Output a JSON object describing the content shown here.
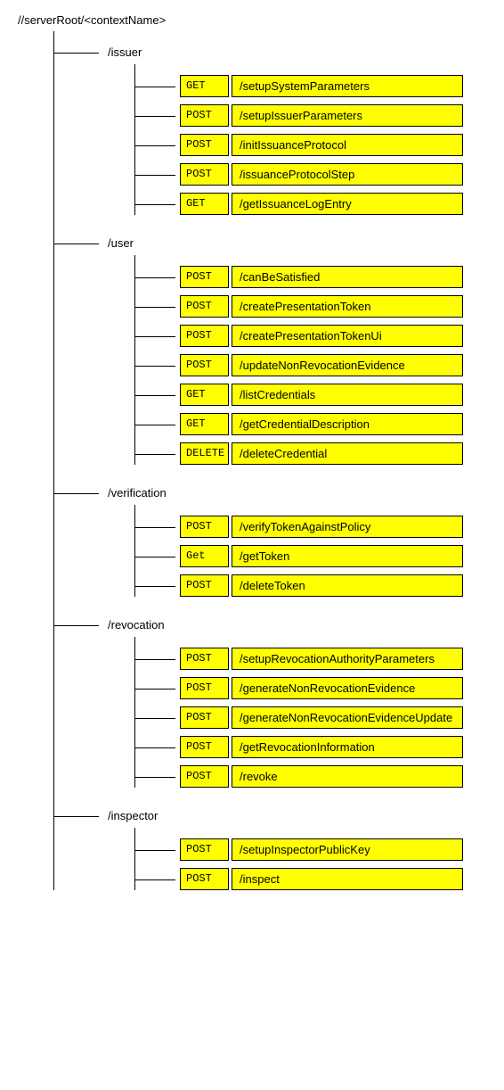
{
  "root": "//serverRoot/<contextName>",
  "sections": [
    {
      "title": "/issuer",
      "endpoints": [
        {
          "method": "GET",
          "path": "/setupSystemParameters"
        },
        {
          "method": "POST",
          "path": "/setupIssuerParameters"
        },
        {
          "method": "POST",
          "path": "/initIssuanceProtocol"
        },
        {
          "method": "POST",
          "path": "/issuanceProtocolStep"
        },
        {
          "method": "GET",
          "path": "/getIssuanceLogEntry"
        }
      ]
    },
    {
      "title": "/user",
      "endpoints": [
        {
          "method": "POST",
          "path": "/canBeSatisfied"
        },
        {
          "method": "POST",
          "path": "/createPresentationToken"
        },
        {
          "method": "POST",
          "path": "/createPresentationTokenUi"
        },
        {
          "method": "POST",
          "path": "/updateNonRevocationEvidence"
        },
        {
          "method": "GET",
          "path": "/listCredentials"
        },
        {
          "method": "GET",
          "path": "/getCredentialDescription"
        },
        {
          "method": "DELETE",
          "path": "/deleteCredential"
        }
      ]
    },
    {
      "title": "/verification",
      "endpoints": [
        {
          "method": "POST",
          "path": "/verifyTokenAgainstPolicy"
        },
        {
          "method": "Get",
          "path": "/getToken"
        },
        {
          "method": "POST",
          "path": "/deleteToken"
        }
      ]
    },
    {
      "title": "/revocation",
      "endpoints": [
        {
          "method": "POST",
          "path": "/setupRevocationAuthorityParameters"
        },
        {
          "method": "POST",
          "path": "/generateNonRevocationEvidence"
        },
        {
          "method": "POST",
          "path": "/generateNonRevocationEvidenceUpdate"
        },
        {
          "method": "POST",
          "path": "/getRevocationInformation"
        },
        {
          "method": "POST",
          "path": "/revoke"
        }
      ]
    },
    {
      "title": "/inspector",
      "endpoints": [
        {
          "method": "POST",
          "path": "/setupInspectorPublicKey"
        },
        {
          "method": "POST",
          "path": "/inspect"
        }
      ]
    }
  ]
}
